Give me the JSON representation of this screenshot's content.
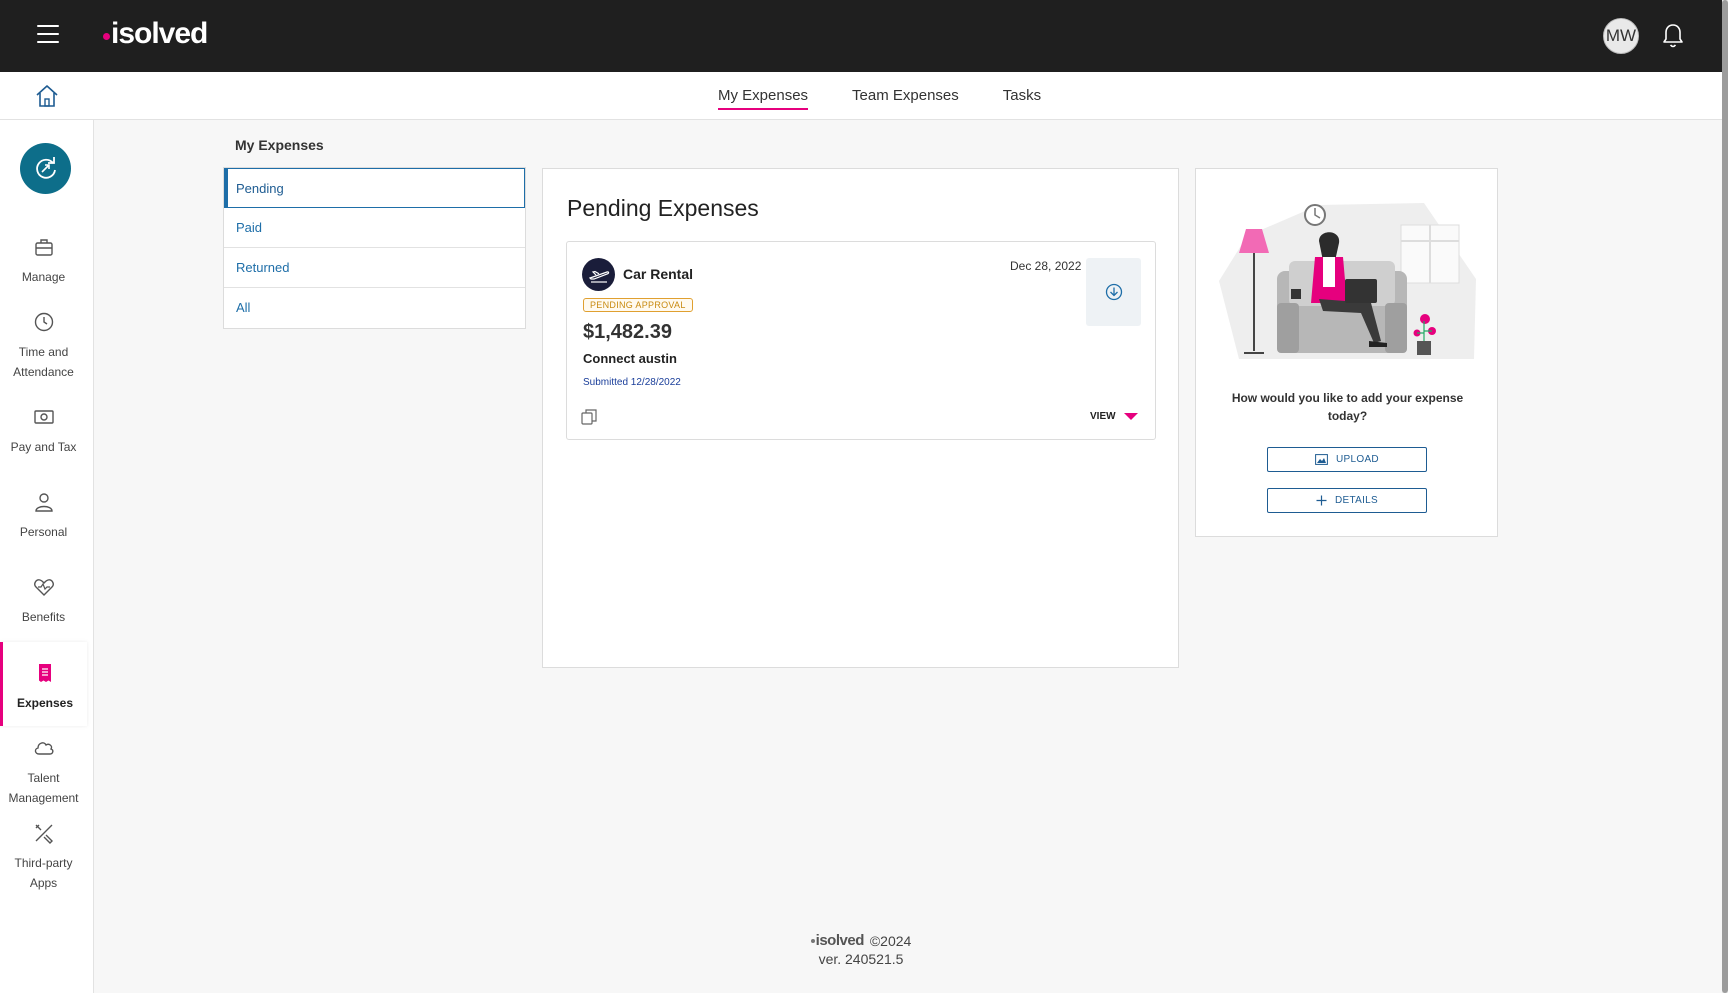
{
  "brand": {
    "logo_text": "isolved",
    "accent_color": "#e6007e",
    "primary_color": "#1e5c92"
  },
  "header": {
    "avatar_initials": "MW",
    "menu_icon": "hamburger-icon",
    "notification_icon": "bell-icon"
  },
  "tabs": [
    {
      "label": "My Expenses",
      "active": true
    },
    {
      "label": "Team Expenses",
      "active": false
    },
    {
      "label": "Tasks",
      "active": false
    }
  ],
  "sidebar": {
    "items": [
      {
        "label": "Manage",
        "icon": "briefcase-icon"
      },
      {
        "label": "Time and Attendance",
        "icon": "clock-icon"
      },
      {
        "label": "Pay and Tax",
        "icon": "money-icon"
      },
      {
        "label": "Personal",
        "icon": "person-icon"
      },
      {
        "label": "Benefits",
        "icon": "heart-icon"
      },
      {
        "label": "Expenses",
        "icon": "receipt-icon",
        "active": true
      },
      {
        "label": "Talent Management",
        "icon": "cloud-icon"
      },
      {
        "label": "Third-party Apps",
        "icon": "tools-icon"
      }
    ]
  },
  "main": {
    "section_title": "My Expenses",
    "filters": [
      {
        "label": "Pending",
        "active": true
      },
      {
        "label": "Paid"
      },
      {
        "label": "Returned"
      },
      {
        "label": "All"
      }
    ],
    "panel_title": "Pending Expenses",
    "expense": {
      "category": "Car Rental",
      "date": "Dec 28, 2022",
      "status": "PENDING APPROVAL",
      "amount": "$1,482.39",
      "merchant": "Connect austin",
      "submitted": "Submitted 12/28/2022",
      "view_label": "VIEW"
    },
    "add_expense": {
      "question": "How would you like to add your expense today?",
      "upload_label": "UPLOAD",
      "details_label": "DETAILS"
    }
  },
  "footer": {
    "logo_text": "isolved",
    "copyright": "©2024",
    "version": "ver. 240521.5"
  }
}
